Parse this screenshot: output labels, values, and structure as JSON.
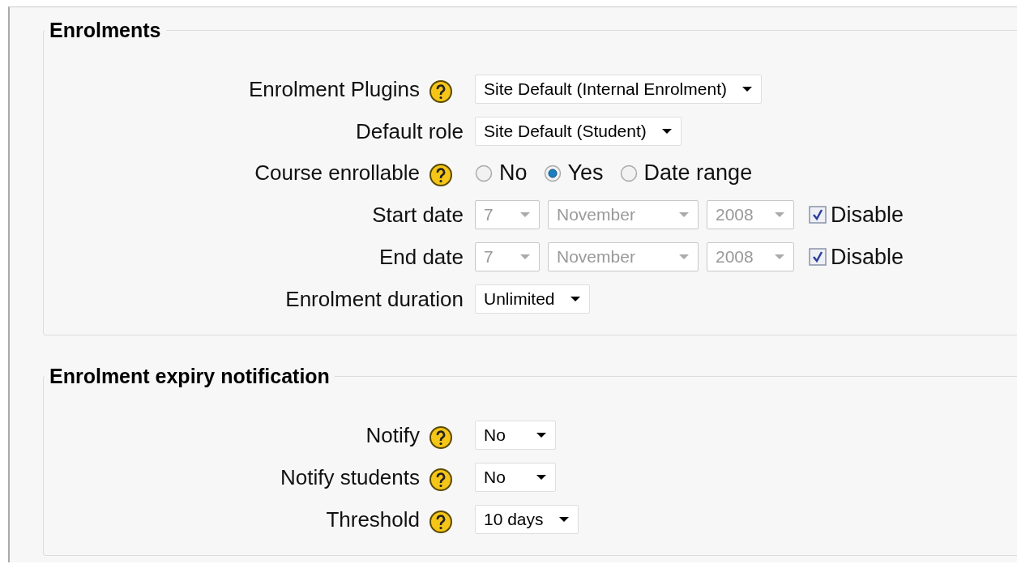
{
  "sections": [
    {
      "title": "Enrolments",
      "rows": [
        {
          "kind": "select",
          "label": "Enrolment Plugins",
          "help": true,
          "value": "Site Default (Internal Enrolment)"
        },
        {
          "kind": "select",
          "label": "Default role",
          "help": false,
          "value": "Site Default (Student)"
        },
        {
          "kind": "radio",
          "label": "Course enrollable",
          "help": true,
          "options": [
            {
              "label": "No",
              "selected": false
            },
            {
              "label": "Yes",
              "selected": true
            },
            {
              "label": "Date range",
              "selected": false
            }
          ]
        },
        {
          "kind": "date",
          "label": "Start date",
          "help": false,
          "disabled": true,
          "fields": [
            "7",
            "November",
            "2008"
          ],
          "checkbox": {
            "label": "Disable",
            "checked": true
          }
        },
        {
          "kind": "date",
          "label": "End date",
          "help": false,
          "disabled": true,
          "fields": [
            "7",
            "November",
            "2008"
          ],
          "checkbox": {
            "label": "Disable",
            "checked": true
          }
        },
        {
          "kind": "select",
          "label": "Enrolment duration",
          "help": false,
          "value": "Unlimited"
        }
      ]
    },
    {
      "title": "Enrolment expiry notification",
      "rows": [
        {
          "kind": "select",
          "label": "Notify",
          "help": true,
          "value": "No"
        },
        {
          "kind": "select",
          "label": "Notify students",
          "help": true,
          "value": "No"
        },
        {
          "kind": "select",
          "label": "Threshold",
          "help": true,
          "value": "10 days"
        }
      ]
    }
  ]
}
